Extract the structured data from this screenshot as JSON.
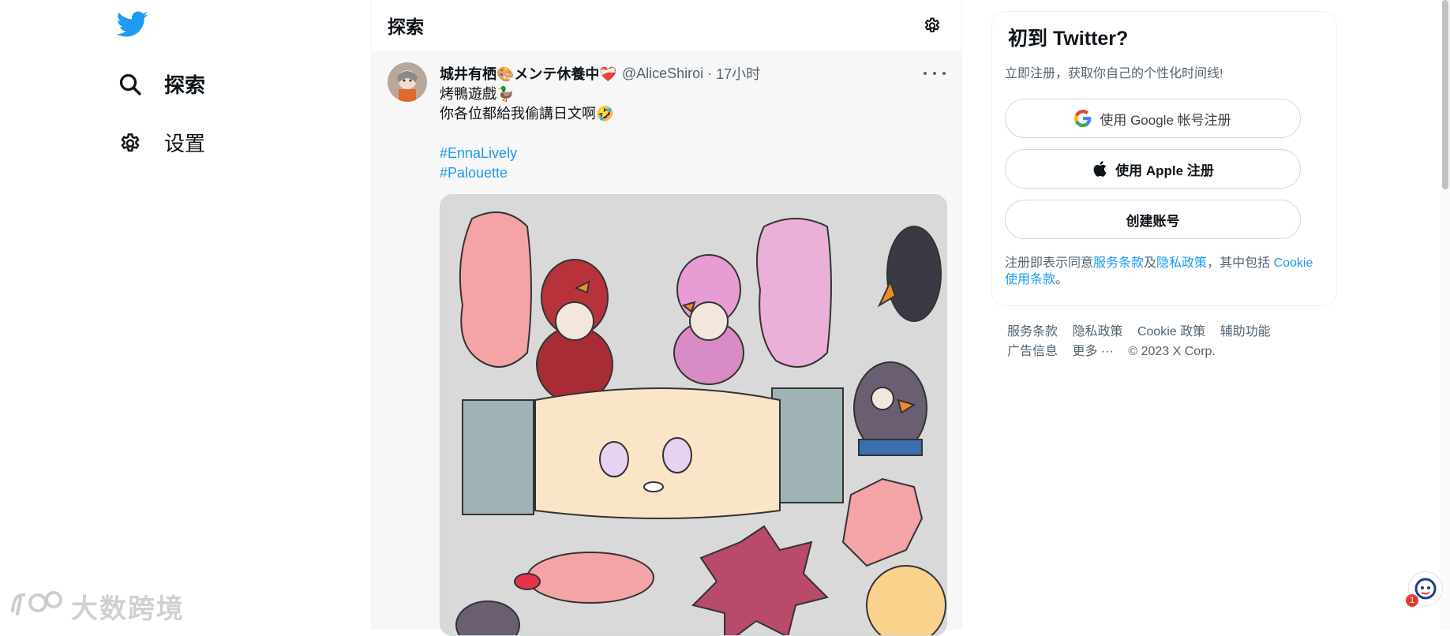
{
  "nav": {
    "explore_label": "探索",
    "settings_label": "设置"
  },
  "main": {
    "title": "探索"
  },
  "tweet": {
    "name": "城井有栖🎨メンテ休養中❤️‍🩹",
    "handle": "@AliceShiroi",
    "separator": "·",
    "time": "17小时",
    "text_line1": "烤鴨遊戲🦆",
    "text_line2": "你各位都給我偷講日文啊🤣",
    "hashtags": [
      "#EnnaLively",
      "#Palouette"
    ]
  },
  "signup": {
    "title": "初到 Twitter?",
    "subtitle": "立即注册，获取你自己的个性化时间线!",
    "google_button": "使用 Google 帐号注册",
    "apple_button": "使用 Apple 注册",
    "create_button": "创建账号",
    "legal_prefix": "注册即表示同意",
    "terms_link": "服务条款",
    "and_text": "及",
    "privacy_link": "隐私政策",
    "including_text": "，其中包括",
    "cookie_link": "Cookie 使用条款",
    "period": "。"
  },
  "footer": {
    "links": [
      "服务条款",
      "隐私政策",
      "Cookie 政策",
      "辅助功能",
      "广告信息",
      "更多 ···"
    ],
    "copyright": "© 2023 X Corp."
  },
  "watermark": {
    "text": "大数跨境"
  },
  "chat_widget": {
    "badge": "1"
  },
  "colors": {
    "accent": "#1d9bf0",
    "text": "#0f1419",
    "muted": "#536471"
  }
}
